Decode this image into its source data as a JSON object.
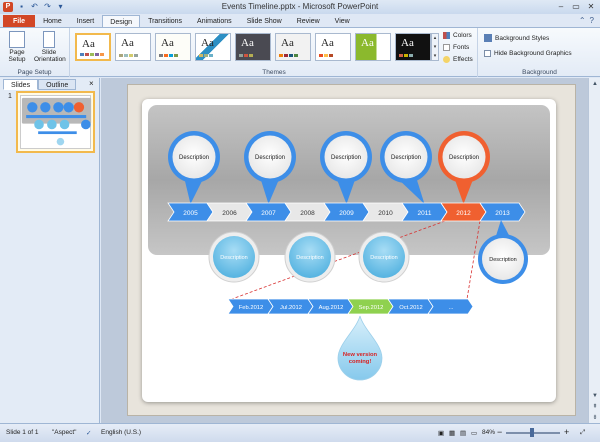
{
  "window": {
    "title": "Events Timeline.pptx - Microsoft PowerPoint",
    "app_letter": "P",
    "controls": [
      "–",
      "▭",
      "✕"
    ]
  },
  "ribbon_tabs": [
    "File",
    "Home",
    "Insert",
    "Design",
    "Transitions",
    "Animations",
    "Slide Show",
    "Review",
    "View"
  ],
  "ribbon_tab_right": [
    "?"
  ],
  "page_setup": {
    "page_setup_label": "Page Setup",
    "orientation_label": "Slide Orientation",
    "group_label": "Page Setup"
  },
  "themes": {
    "group_label": "Themes",
    "sample_text": "Aa",
    "colors_label": "Colors",
    "fonts_label": "Fonts",
    "effects_label": "Effects"
  },
  "background": {
    "styles_label": "Background Styles",
    "hide_label": "Hide Background Graphics",
    "group_label": "Background"
  },
  "left_pane": {
    "tabs": [
      "Slides",
      "Outline"
    ],
    "close_glyph": "×",
    "slide_number": "1"
  },
  "slide": {
    "top_bubbles": [
      {
        "label": "Description",
        "color": "#3d8ee8"
      },
      {
        "label": "Description",
        "color": "#3d8ee8"
      },
      {
        "label": "Description",
        "color": "#3d8ee8"
      },
      {
        "label": "Description",
        "color": "#3d8ee8"
      },
      {
        "label": "Description",
        "color": "#f06030"
      }
    ],
    "years": [
      "2005",
      "2006",
      "2007",
      "2008",
      "2009",
      "2010",
      "2011",
      "2012",
      "2013"
    ],
    "bottom_bubbles": [
      "Description",
      "Description",
      "Description",
      "Description"
    ],
    "months": [
      "Feb.2012",
      "Jul.2012",
      "Aug.2012",
      "Sep.2012",
      "Oct.2012",
      "..."
    ],
    "drop_label": "New version coming!"
  },
  "status": {
    "slide_of": "Slide 1 of 1",
    "theme": "\"Aspect\"",
    "language": "English (U.S.)",
    "zoom": "84%"
  },
  "colors": {
    "accent_blue": "#3d8ee8",
    "accent_orange": "#f06030",
    "accent_green": "#8fd14f",
    "file_tab": "#d24726"
  }
}
